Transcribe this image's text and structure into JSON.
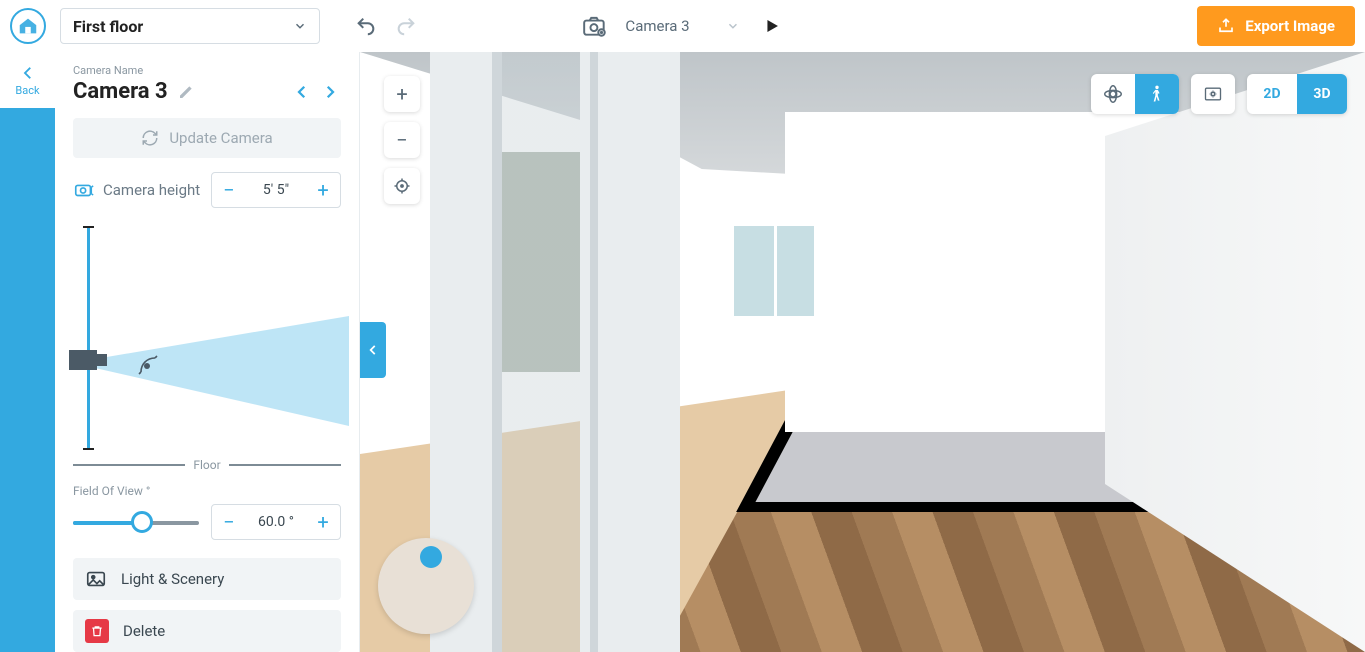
{
  "topbar": {
    "floor_selected": "First floor",
    "camera_selected": "Camera 3",
    "export_label": "Export Image"
  },
  "back": {
    "label": "Back"
  },
  "sidebar": {
    "camera_label": "Camera Name",
    "camera_name": "Camera 3",
    "update_label": "Update Camera",
    "height_label": "Camera height",
    "height_value": "5' 5\"",
    "floor_label": "Floor",
    "fov_label": "Field Of View °",
    "fov_value": "60.0 °",
    "light_label": "Light & Scenery",
    "delete_label": "Delete"
  },
  "viewport": {
    "view_modes": {
      "twod": "2D",
      "threed": "3D",
      "active": "3D"
    },
    "nav_modes": {
      "active": "walk"
    }
  },
  "colors": {
    "accent": "#33a9e0",
    "export": "#ff9a1e",
    "danger": "#e63946"
  }
}
